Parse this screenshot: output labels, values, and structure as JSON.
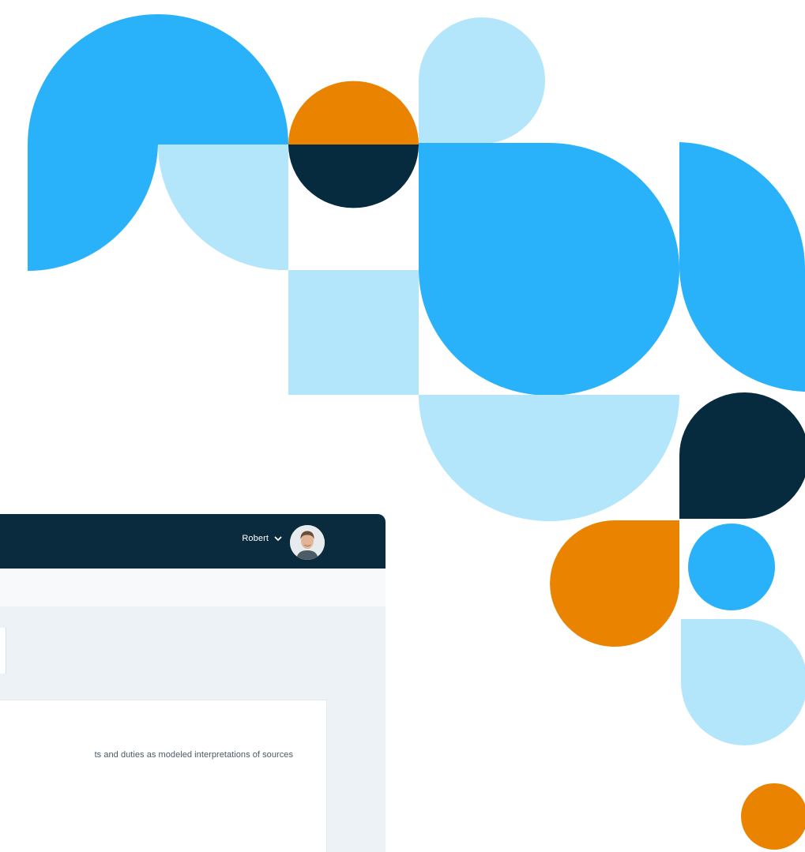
{
  "header": {
    "user_name": "Robert",
    "user_menu_icon": "chevron-down-icon",
    "avatar_icon": "avatar"
  },
  "card": {
    "description": "ts and duties as modeled interpretations of sources"
  },
  "colors": {
    "navy": "#0a2b3e",
    "blue": "#29b2f9",
    "light_blue": "#b3e6fb",
    "orange": "#e98300",
    "panel_bg": "#edf2f7"
  }
}
